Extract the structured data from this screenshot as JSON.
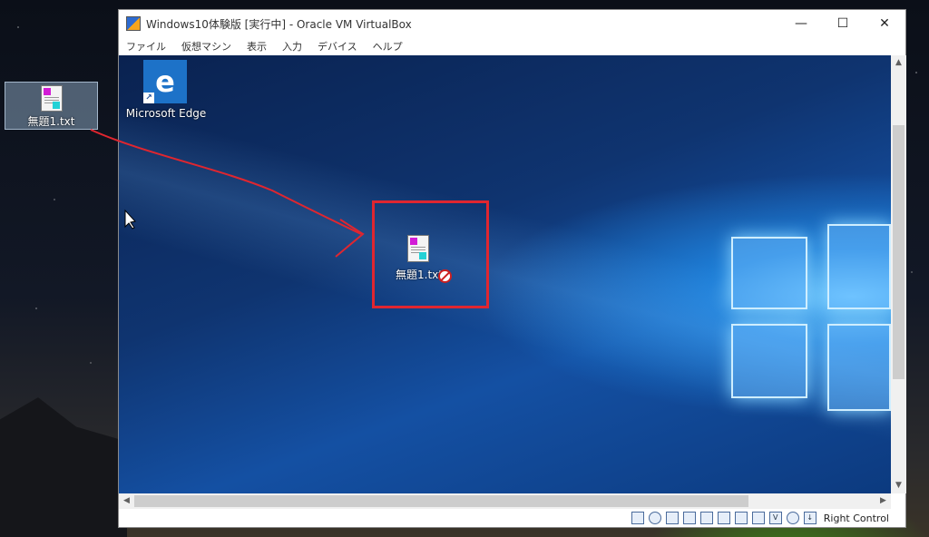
{
  "host_desktop": {
    "file_icon_label": "無題1.txt"
  },
  "vbox": {
    "title": "Windows10体験版 [実行中] - Oracle VM VirtualBox",
    "controls": {
      "minimize": "—",
      "maximize": "☐",
      "close": "✕"
    },
    "menu": [
      "ファイル",
      "仮想マシン",
      "表示",
      "入力",
      "デバイス",
      "ヘルプ"
    ],
    "guest": {
      "edge_label": "Microsoft Edge",
      "edge_glyph": "e",
      "dropped_file_label": "無題1.txt"
    },
    "status": {
      "host_key_label": "Right Control",
      "icons": [
        "hdd-icon",
        "optical-icon",
        "network-icon",
        "usb-icon",
        "shared-folder-icon",
        "display-icon",
        "recording-icon",
        "cpu-icon",
        "vt-icon",
        "mouse-icon",
        "keyboard-icon"
      ]
    }
  },
  "annotation": {
    "arrow_color": "#e0262f",
    "box_color": "#e02630"
  }
}
